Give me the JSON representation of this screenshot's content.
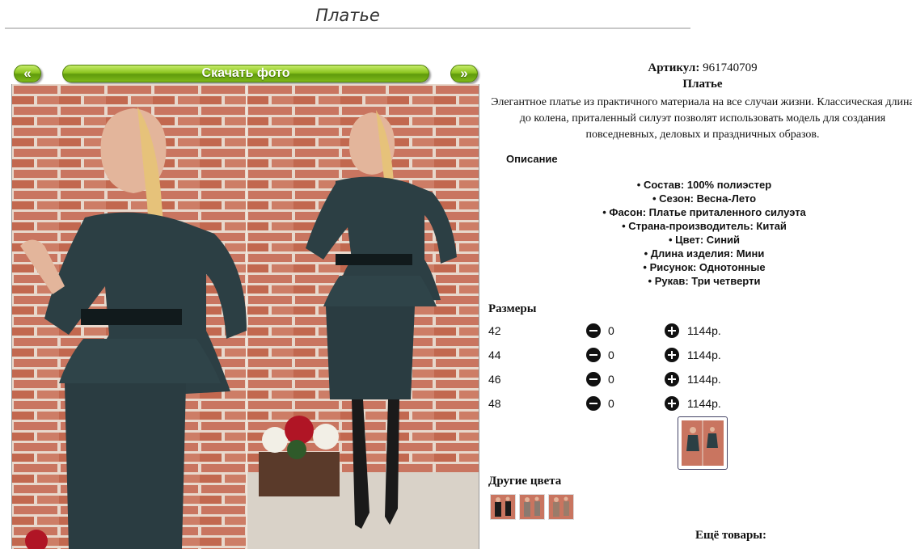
{
  "page": {
    "title": "Платье"
  },
  "gallery": {
    "prev_label": "«",
    "download_label": "Скачать фото",
    "next_label": "»"
  },
  "product": {
    "article_label": "Артикул:",
    "article_value": "961740709",
    "name": "Платье",
    "description": "Элегантное платье из практичного материала на все случаи жизни. Классическая длина до колена, приталенный силуэт позволят использовать модель для создания повседневных, деловых и праздничных образов."
  },
  "details": {
    "title": "Описание",
    "items": [
      "Состав: 100% полиэстер",
      "Сезон: Весна-Лето",
      "Фасон: Платье приталенного силуэта",
      "Страна-производитель: Китай",
      "Цвет: Синий",
      "Длина изделия: Мини",
      "Рисунок: Однотонные",
      "Рукав: Три четверти"
    ]
  },
  "sizes": {
    "title": "Размеры",
    "rows": [
      {
        "size": "42",
        "qty": "0",
        "price": "1144р."
      },
      {
        "size": "44",
        "qty": "0",
        "price": "1144р."
      },
      {
        "size": "46",
        "qty": "0",
        "price": "1144р."
      },
      {
        "size": "48",
        "qty": "0",
        "price": "1144р."
      }
    ]
  },
  "other_colors": {
    "title": "Другие цвета"
  },
  "more": {
    "title": "Ещё товары:"
  },
  "colors": {
    "accent_green": "#8cc520",
    "dress_teal": "#2c3f44",
    "brick": "#c8705a"
  }
}
